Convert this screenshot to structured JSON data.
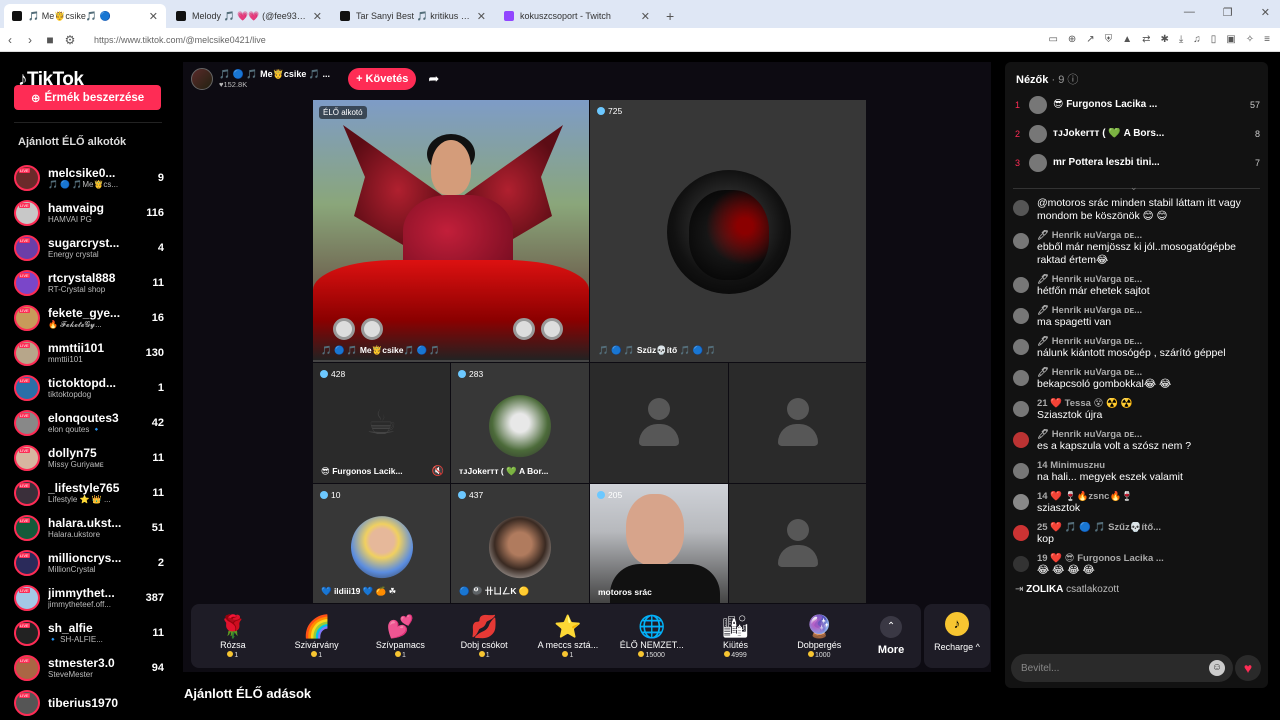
{
  "browser": {
    "tabs": [
      {
        "label": "🎵 Me🤴csike🎵 🔵"
      },
      {
        "label": "Melody 🎵 💗💗 (@fee939) ÉLŐ"
      },
      {
        "label": "Tar Sanyi Best 🎵 kritikus 🎵 (@szoy"
      },
      {
        "label": "kokuszcsoport - Twitch"
      }
    ],
    "url": "https://www.tiktok.com/@melcsike0421/live"
  },
  "sidebar": {
    "logo": "TikTok",
    "coins_button": "Érmék beszerzése",
    "recommended_title": "Ajánlott ÉLŐ alkotók",
    "creators": [
      {
        "name": "melcsike0...",
        "sub": "🎵 🔵 🎵Me🤴cs...",
        "count": "9"
      },
      {
        "name": "hamvaipg",
        "sub": "HAMVAI PG",
        "count": "116"
      },
      {
        "name": "sugarcryst...",
        "sub": "Energy crystal",
        "count": "4"
      },
      {
        "name": "rtcrystal888",
        "sub": "RT-Crystal shop",
        "count": "11"
      },
      {
        "name": "fekete_gye...",
        "sub": "🔥 𝓕𝓮𝓴𝓮𝓽𝓮𝓖𝔂...",
        "count": "16"
      },
      {
        "name": "mmttii101",
        "sub": "mmttii101",
        "count": "130"
      },
      {
        "name": "tictoktopd...",
        "sub": "tiktoktopdog",
        "count": "1"
      },
      {
        "name": "elonqoutes3",
        "sub": "elon qoutes 🔹",
        "count": "42"
      },
      {
        "name": "dollyn75",
        "sub": "Missy Guriyaᴍᴇ",
        "count": "11"
      },
      {
        "name": "_lifestyle765",
        "sub": "Lifestyle ⭐ 👑 ...",
        "count": "11"
      },
      {
        "name": "halara.ukst...",
        "sub": "Halara.ukstore",
        "count": "51"
      },
      {
        "name": "millioncrys...",
        "sub": "MillionCrystal",
        "count": "2"
      },
      {
        "name": "jimmythet...",
        "sub": "jimmytheteef.off...",
        "count": "387"
      },
      {
        "name": "sh_alfie",
        "sub": "🔹 SH-ALFIE...",
        "count": "11"
      },
      {
        "name": "stmester3.0",
        "sub": "SteveMester",
        "count": "94"
      },
      {
        "name": "tiberius1970",
        "sub": "",
        "count": ""
      }
    ]
  },
  "host": {
    "name": "🎵 🔵 🎵 Me🤴csike 🎵 ...",
    "likes": "♥152.8K",
    "follow_label": "+ Követés"
  },
  "grid": {
    "main": {
      "live_tag": "ÉLŐ alkotó",
      "name": "🎵 🔵 🎵 Me🤴csike🎵 🔵 🎵"
    },
    "top_right": {
      "count": "725",
      "name": "🎵 🔵 🎵 Szűz💀ítő 🎵 🔵 🎵"
    },
    "row2": [
      {
        "count": "428",
        "name": "😎 Furgonos Lacik..."
      },
      {
        "count": "283",
        "name": "ᴛᴊJokerтт ( 💚 A Bor..."
      },
      {
        "count": "",
        "name": ""
      },
      {
        "count": "",
        "name": ""
      }
    ],
    "row3": [
      {
        "count": "10",
        "name": "💙 ildiii19 💙 🍊 ☘"
      },
      {
        "count": "437",
        "name": "🔵 🎱 卄ㄩㄥK 🟡"
      },
      {
        "count": "205",
        "name": "motoros srác"
      },
      {
        "count": "",
        "name": ""
      }
    ]
  },
  "gifts": [
    {
      "icon": "🌹",
      "name": "Rózsa",
      "price": "1"
    },
    {
      "icon": "🌈",
      "name": "Szivárvány",
      "price": "1"
    },
    {
      "icon": "💕",
      "name": "Szívpamacs",
      "price": "1"
    },
    {
      "icon": "💋",
      "name": "Dobj csókot",
      "price": "1"
    },
    {
      "icon": "⭐",
      "name": "A meccs sztá...",
      "price": "1"
    },
    {
      "icon": "🌐",
      "name": "ÉLŐ NEMZET...",
      "price": "15000"
    },
    {
      "icon": "🏙",
      "name": "Kiütés",
      "price": "4999"
    },
    {
      "icon": "🔮",
      "name": "Dobpergés",
      "price": "1000"
    }
  ],
  "more_label": "More",
  "recharge_label": "Recharge ^",
  "recommended_lives": "Ajánlott ÉLŐ adások",
  "viewers": {
    "title": "Nézők",
    "count": "· 9",
    "list": [
      {
        "rank": "1",
        "name": "😎 Furgonos Lacika ...",
        "score": "57"
      },
      {
        "rank": "2",
        "name": "ᴛᴊJokerтт ( 💚 A Bors...",
        "score": "8"
      },
      {
        "rank": "3",
        "name": "mr Pottera leszbi tini...",
        "score": "7"
      }
    ]
  },
  "chat": [
    {
      "user": "",
      "text": "@motoros srác minden stabil láttam itt vagy mondom be köszönök 😊 😊"
    },
    {
      "user": "🖊 Henrik ʜuVarga ᴅᴇ...",
      "text": "ebből már nemjössz ki jól..mosogatógépbe raktad értem😂"
    },
    {
      "user": "🖊 Henrik ʜuVarga ᴅᴇ...",
      "text": "hétfőn már ehetek sajtot"
    },
    {
      "user": "🖊 Henrik ʜuVarga ᴅᴇ...",
      "text": "ma spagetti van"
    },
    {
      "user": "🖊 Henrik ʜuVarga ᴅᴇ...",
      "text": "nálunk kiántott mosógép , szárító géppel"
    },
    {
      "user": "🖊 Henrik ʜuVarga ᴅᴇ...",
      "text": "bekapcsoló gombokkal😂 😂"
    },
    {
      "user": "21 ❤️ Tessa 😵 ☢️ ☢️",
      "text": "Sziasztok újra"
    },
    {
      "user": "🖊 Henrik ʜuVarga ᴅᴇ...",
      "text": "es a kapszula volt a szósz nem ?"
    },
    {
      "user": "14 Minimuszʜu",
      "text": "na hali... megyek eszek valamit"
    },
    {
      "user": "14 ❤️ 🍷🔥zsnc🔥🍷",
      "text": "sziasztok"
    },
    {
      "user": "25 ❤️ 🎵 🔵 🎵 Szűz💀ítő...",
      "text": "kop"
    },
    {
      "user": "19 ❤️ 😎 Furgonos Lacika ...",
      "text": "😂 😂 😂 😂"
    }
  ],
  "join": {
    "user": "ZOLIKA",
    "text": "csatlakozott"
  },
  "input_placeholder": "Bevitel..."
}
